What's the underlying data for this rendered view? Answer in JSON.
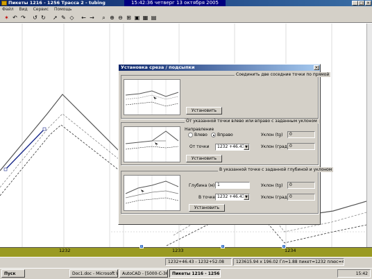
{
  "window": {
    "title": "Пикеты 1216 - 1256 Трасса 2 - tubing",
    "clock_banner": "15:42:36 четверг 13 октября 2005",
    "min": "_",
    "max": "□",
    "close": "×"
  },
  "menu": [
    "Файл",
    "Вид",
    "Сервис",
    "Помощь"
  ],
  "toolbar": {
    "icons": [
      "cut-icon",
      "undo-icon",
      "redo-icon",
      "undo-all-icon",
      "refresh-icon",
      "arrow-icon",
      "pen-icon",
      "eraser-icon",
      "back-arrow-icon",
      "forward-arrow-icon",
      "zoom-icon",
      "zoom-in-icon",
      "zoom-out-icon",
      "zoom-window-icon",
      "zoom-extents-icon",
      "grid-icon",
      "table-icon"
    ],
    "glyphs": [
      "✶",
      "↶",
      "↷",
      "↺",
      "↻",
      "➚",
      "✎",
      "◇",
      "←",
      "→",
      "⌕",
      "⊕",
      "⊖",
      "⊞",
      "▣",
      "▦",
      "▤"
    ]
  },
  "ruler": {
    "labels": [
      "1232",
      "1233",
      "1234"
    ],
    "markers": [
      "U",
      "U",
      "U"
    ]
  },
  "status": {
    "left": "1232+46.43 - 1232+52.08",
    "right": "123615.94 x 196.02 Гл=1.88 пикет=1232 плюс=48.08"
  },
  "dialog": {
    "title": "Установка среза / подсыпки",
    "close": "×",
    "section1": {
      "title": "Соединить две соседние точки по прямой",
      "button": "Установить"
    },
    "section2": {
      "title": "От указанной точки влево или вправо с заданным уклоном",
      "direction_label": "Направление",
      "left_option": "Влево",
      "right_option": "Вправо",
      "from_point_label": "От точки",
      "from_point_value": "1232 +46.43",
      "slope_tg_label": "Уклон (tg)",
      "slope_tg_value": "0",
      "slope_deg_label": "Уклон (град.)",
      "slope_deg_value": "0",
      "button": "Установить"
    },
    "section3": {
      "title": "В указанной точке с заданной глубиной и уклоном",
      "depth_label": "Глубина (м)",
      "depth_value": "1",
      "at_point_label": "В точке",
      "at_point_value": "1232 +46.43",
      "slope_tg_label": "Уклон (tg)",
      "slope_tg_value": "0",
      "slope_deg_label": "Уклон (град.)",
      "slope_deg_value": "0",
      "button": "Установить"
    }
  },
  "taskbar": {
    "start": "Пуск",
    "tasks": [
      "Doc1.doc - Microsoft Word",
      "AutoCAD - [5000-C-36-4...",
      "Пикеты 1216 - 1256 Т..."
    ],
    "tray_time": "15:42"
  },
  "colors": {
    "title_blue": "#0a246a",
    "ruler_olive": "#9a9a22",
    "face": "#d4d0c8"
  }
}
